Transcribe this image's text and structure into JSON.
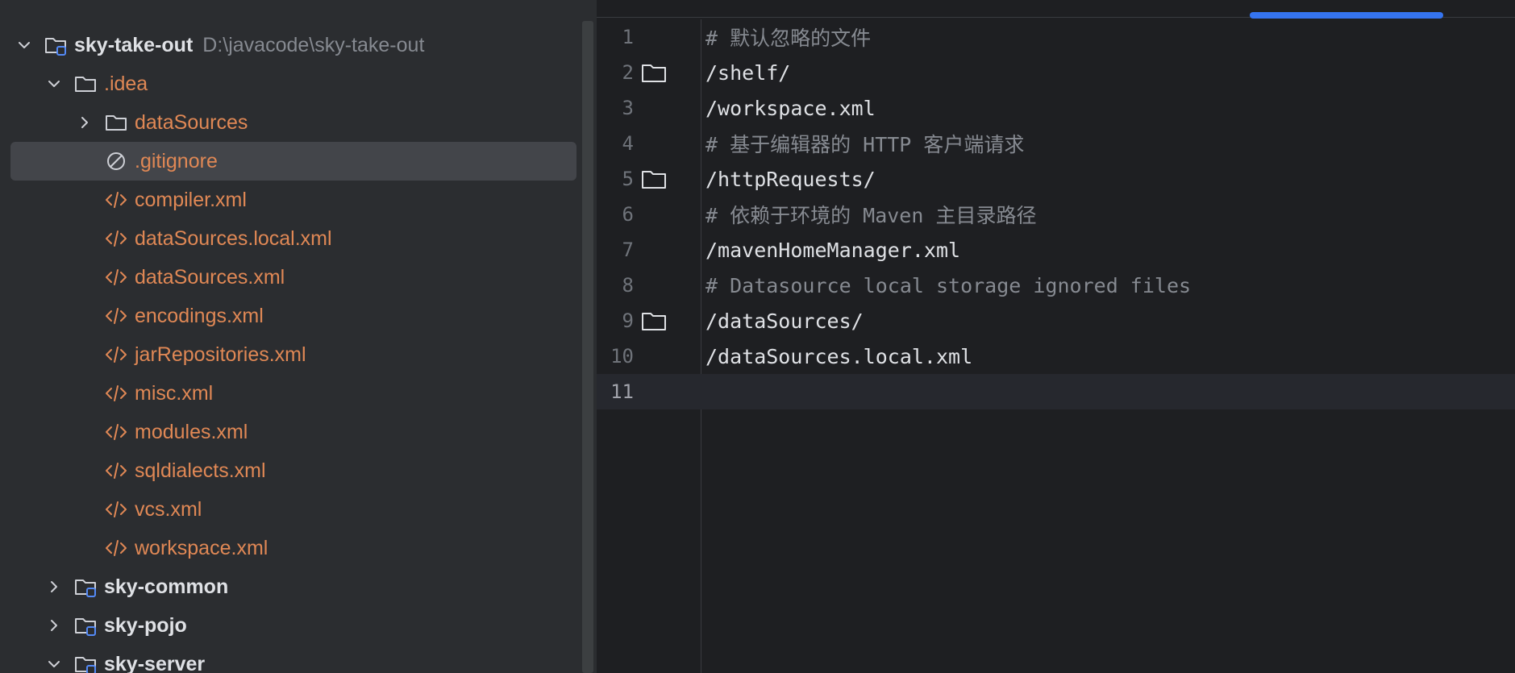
{
  "project_tree": {
    "root": {
      "name": "sky-take-out",
      "path": "D:\\javacode\\sky-take-out"
    },
    "items": [
      {
        "label": "sky-take-out",
        "type": "module",
        "depth": 0,
        "expanded": true
      },
      {
        "label": ".idea",
        "type": "folder",
        "depth": 1,
        "expanded": true
      },
      {
        "label": "dataSources",
        "type": "folder",
        "depth": 2,
        "expanded": false
      },
      {
        "label": ".gitignore",
        "type": "ignore-file",
        "depth": 2,
        "selected": true
      },
      {
        "label": "compiler.xml",
        "type": "xml",
        "depth": 2
      },
      {
        "label": "dataSources.local.xml",
        "type": "xml",
        "depth": 2
      },
      {
        "label": "dataSources.xml",
        "type": "xml",
        "depth": 2
      },
      {
        "label": "encodings.xml",
        "type": "xml",
        "depth": 2
      },
      {
        "label": "jarRepositories.xml",
        "type": "xml",
        "depth": 2
      },
      {
        "label": "misc.xml",
        "type": "xml",
        "depth": 2
      },
      {
        "label": "modules.xml",
        "type": "xml",
        "depth": 2
      },
      {
        "label": "sqldialects.xml",
        "type": "xml",
        "depth": 2
      },
      {
        "label": "vcs.xml",
        "type": "xml",
        "depth": 2
      },
      {
        "label": "workspace.xml",
        "type": "xml",
        "depth": 2
      },
      {
        "label": "sky-common",
        "type": "module",
        "depth": 1,
        "expanded": false
      },
      {
        "label": "sky-pojo",
        "type": "module",
        "depth": 1,
        "expanded": false
      },
      {
        "label": "sky-server",
        "type": "module",
        "depth": 1,
        "expanded": true
      }
    ]
  },
  "editor": {
    "file": ".gitignore",
    "current_line": 11,
    "lines": [
      {
        "num": "1",
        "text": "# 默认忽略的文件",
        "kind": "comment",
        "folder_icon": false
      },
      {
        "num": "2",
        "text": "/shelf/",
        "kind": "normal",
        "folder_icon": true
      },
      {
        "num": "3",
        "text": "/workspace.xml",
        "kind": "normal",
        "folder_icon": false
      },
      {
        "num": "4",
        "text": "# 基于编辑器的 HTTP 客户端请求",
        "kind": "comment",
        "folder_icon": false
      },
      {
        "num": "5",
        "text": "/httpRequests/",
        "kind": "normal",
        "folder_icon": true
      },
      {
        "num": "6",
        "text": "# 依赖于环境的 Maven 主目录路径",
        "kind": "comment",
        "folder_icon": false
      },
      {
        "num": "7",
        "text": "/mavenHomeManager.xml",
        "kind": "normal",
        "folder_icon": false
      },
      {
        "num": "8",
        "text": "# Datasource local storage ignored files",
        "kind": "comment",
        "folder_icon": false
      },
      {
        "num": "9",
        "text": "/dataSources/",
        "kind": "normal",
        "folder_icon": true
      },
      {
        "num": "10",
        "text": "/dataSources.local.xml",
        "kind": "normal",
        "folder_icon": false
      },
      {
        "num": "11",
        "text": "",
        "kind": "normal",
        "folder_icon": false
      }
    ]
  },
  "colors": {
    "panel_bg": "#2b2d30",
    "editor_bg": "#1e1f22",
    "selection": "#43454a",
    "file_orange": "#e08855",
    "accent_blue": "#3574f0"
  },
  "icons": {
    "module": "module-folder-icon",
    "folder": "folder-icon",
    "ignore-file": "ignore-file-icon",
    "xml": "xml-file-icon",
    "expand": "chevron-right-icon",
    "collapse": "chevron-down-icon"
  }
}
